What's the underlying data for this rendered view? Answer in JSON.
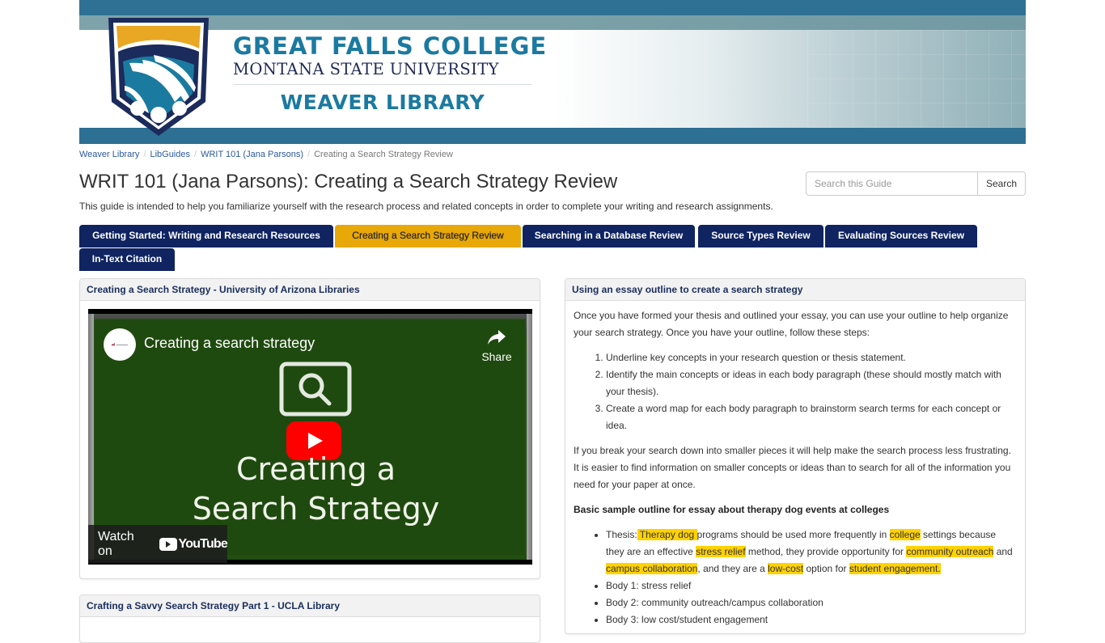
{
  "banner": {
    "line1": "GREAT FALLS COLLEGE",
    "line2": "MONTANA STATE UNIVERSITY",
    "line3": "WEAVER LIBRARY",
    "colors": {
      "teal_band": "#2d7093",
      "logo_blue": "#1b7aa0",
      "logo_navy": "#1e2a55",
      "shield_gold": "#e9a823"
    }
  },
  "breadcrumb": [
    {
      "label": "Weaver Library"
    },
    {
      "label": "LibGuides"
    },
    {
      "label": "WRIT 101 (Jana Parsons)"
    },
    {
      "label": "Creating a Search Strategy Review"
    }
  ],
  "page": {
    "title": "WRIT 101 (Jana Parsons): Creating a Search Strategy Review",
    "description": "This guide is intended to help you familiarize yourself with the research process and related concepts in order to complete your writing and research assignments."
  },
  "search": {
    "placeholder": "Search this Guide",
    "value": "",
    "button_label": "Search"
  },
  "tabs": [
    {
      "label": "Getting Started: Writing and Research Resources",
      "active": false
    },
    {
      "label": "Creating a Search Strategy Review",
      "active": true
    },
    {
      "label": "Searching in a Database Review",
      "active": false
    },
    {
      "label": "Source Types Review",
      "active": false
    },
    {
      "label": "Evaluating Sources Review",
      "active": false
    },
    {
      "label": "In-Text Citation",
      "active": false
    }
  ],
  "colors": {
    "tab_bg": "#0f2461",
    "tab_active_bg": "#e8a807",
    "link": "#2a5a9e",
    "highlight": "#ffd200"
  },
  "left_panels": [
    {
      "heading": "Creating a Search Strategy - University of Arizona Libraries",
      "video": {
        "title": "Creating a search strategy",
        "share_label": "Share",
        "thumbnail_line1": "Creating a",
        "thumbnail_line2": "Search Strategy",
        "watch_on_label": "Watch on",
        "platform": "YouTube"
      }
    },
    {
      "heading": "Crafting a Savvy Search Strategy Part 1 - UCLA Library"
    }
  ],
  "right_panel": {
    "heading": "Using an essay outline to create a search strategy",
    "intro": "Once you have formed your thesis and outlined your essay, you can use your outline to help organize your search strategy. Once you have your outline, follow these steps:",
    "steps": [
      "Underline key concepts in your research question or thesis statement.",
      "Identify the main concepts or ideas in each body paragraph (these should mostly match with your thesis).",
      "Create a word map for each body paragraph to brainstorm search terms for each concept or idea."
    ],
    "para2": "If you break your search down into smaller pieces it will help make the search process less frustrating. It is easier to find information on smaller concepts or ideas than to search for all of the information you need for your paper at once.",
    "outline_heading": "Basic sample outline for essay about therapy dog events at colleges",
    "thesis": {
      "t0": "Thesis:",
      "h1": " Therapy dog ",
      "t1": "programs should be used more frequently in ",
      "h2": "college",
      "t2": " settings because they are an effective ",
      "h3": "stress relief",
      "t3": " method, they provide opportunity for ",
      "h4": "community outreach",
      "t4": " and ",
      "h5": "campus collaboration",
      "t5": ", and they are a ",
      "h6": "low-cost",
      "t6": " option for ",
      "h7": "student engagement."
    },
    "bodies": [
      "Body 1: stress relief",
      "Body 2: community outreach/campus collaboration",
      "Body 3: low cost/student engagement"
    ]
  }
}
